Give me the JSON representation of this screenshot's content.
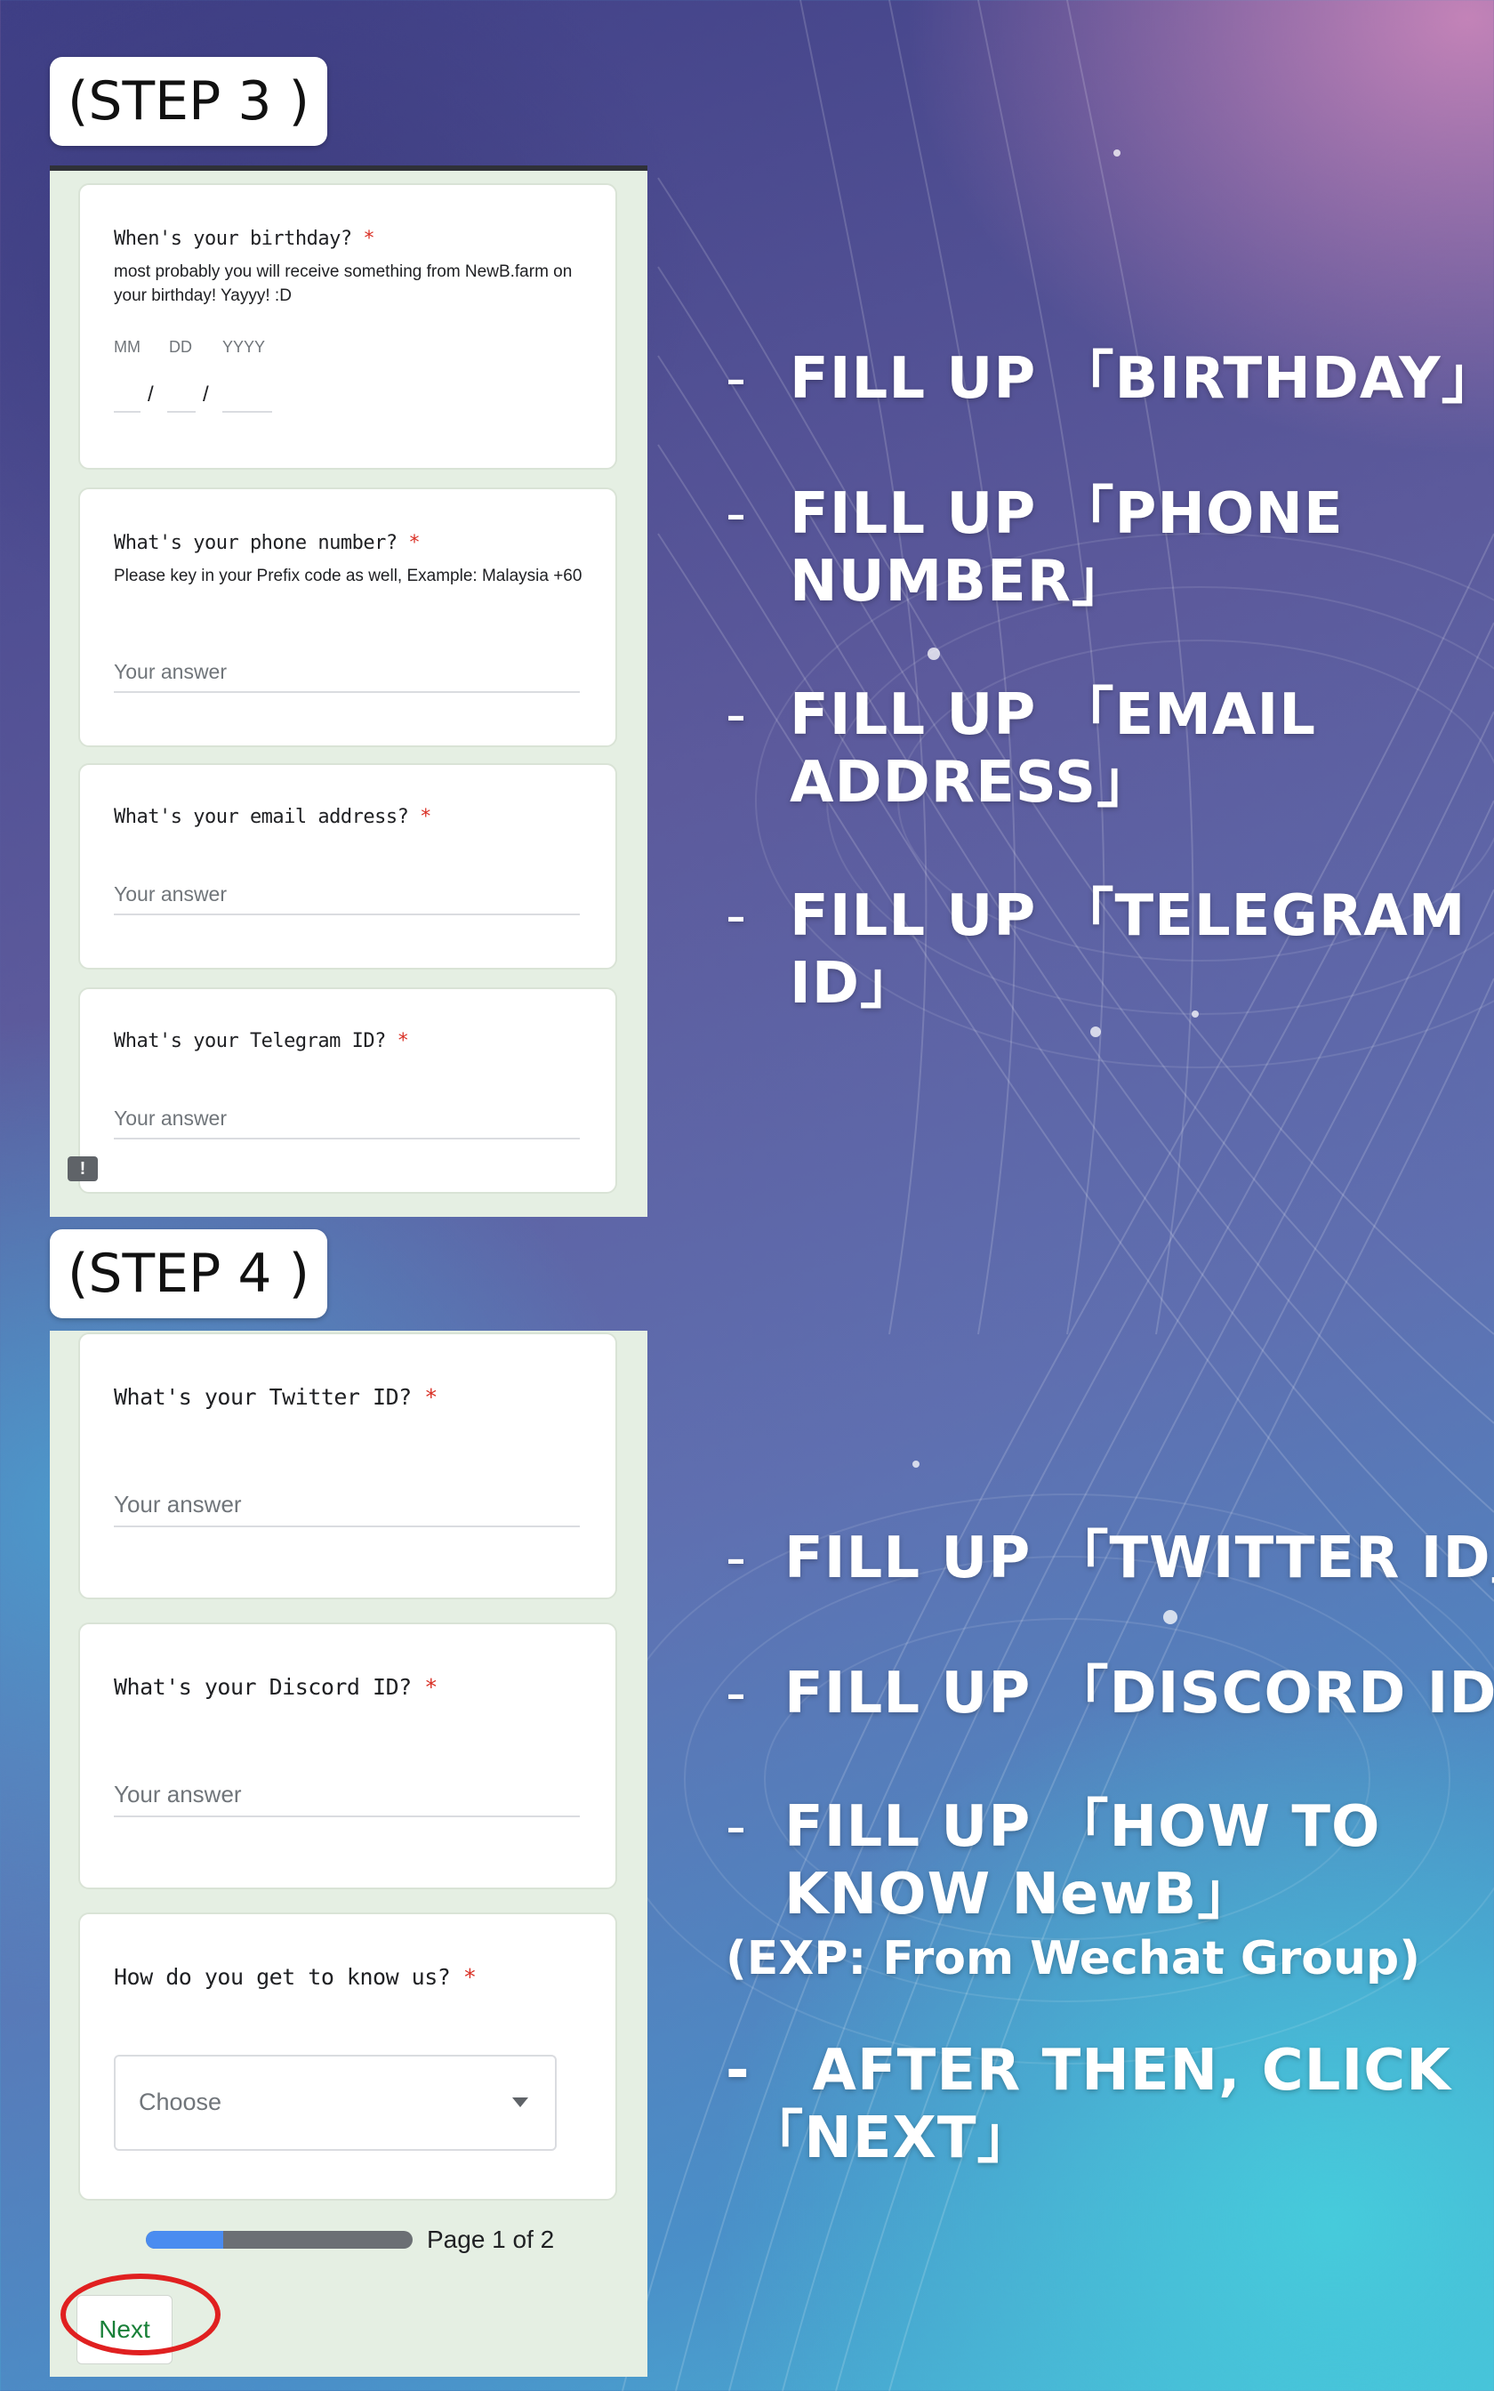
{
  "step3": {
    "label": "(STEP 3 )",
    "birthday": {
      "title": "When's your birthday?",
      "required_mark": "*",
      "description": "most probably you will receive something from NewB.farm on your birthday! Yayyy! :D",
      "month_hint": "MM",
      "day_hint": "DD",
      "year_hint": "YYYY",
      "separator": "/"
    },
    "phone": {
      "title": "What's your phone number?",
      "required_mark": "*",
      "description": "Please key in your Prefix code as well, Example: Malaysia +60",
      "placeholder": "Your answer"
    },
    "email": {
      "title": "What's your email address?",
      "required_mark": "*",
      "placeholder": "Your answer"
    },
    "telegram": {
      "title": "What's your Telegram ID?",
      "required_mark": "*",
      "placeholder": "Your answer"
    },
    "feedback_icon_glyph": "!"
  },
  "step4": {
    "label": "(STEP 4 )",
    "twitter": {
      "title": "What's your Twitter ID?",
      "required_mark": "*",
      "placeholder": "Your answer"
    },
    "discord": {
      "title": "What's your Discord ID?",
      "required_mark": "*",
      "placeholder": "Your answer"
    },
    "how_know": {
      "title": "How do you get to know us?",
      "required_mark": "*",
      "select_value": "Choose"
    },
    "progress": {
      "fraction": 0.29,
      "page_text": "Page 1 of 2"
    },
    "next_label": "Next"
  },
  "instructions": {
    "dash": "-",
    "birthday": "FILL UP 「BIRTHDAY」",
    "phone": "FILL UP 「PHONE\nNUMBER」",
    "email": "FILL UP 「EMAIL\nADDRESS」",
    "telegram": "FILL UP 「TELEGRAM\nID」",
    "twitter": "FILL UP 「TWITTER ID」",
    "discord": "FILL UP 「DISCORD ID」",
    "how_know": "FILL UP 「HOW TO\nKNOW NewB」",
    "how_know_example": "(EXP: From Wechat Group)",
    "next": "-   AFTER THEN, CLICK\n 「NEXT」"
  },
  "colors": {
    "required": "#d93025",
    "next_text": "#188038",
    "progress_fill": "#4a8cf0",
    "highlight_oval": "#e02020",
    "form_background": "#e5efe3"
  }
}
